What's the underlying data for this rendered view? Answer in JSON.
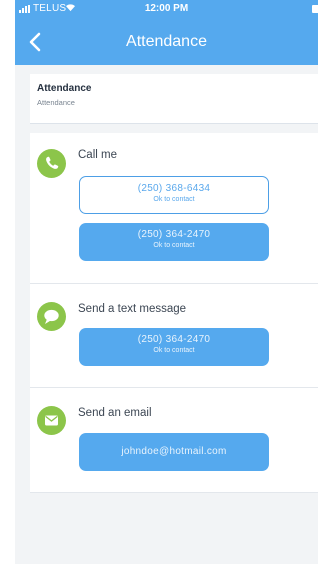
{
  "status_bar": {
    "carrier": "TELUS",
    "time": "12:00 PM"
  },
  "nav": {
    "title": "Attendance",
    "back_icon": "chevron-left-icon"
  },
  "header_card": {
    "title": "Attendance",
    "subtitle": "Attendance"
  },
  "call": {
    "label": "Call me",
    "icon": "phone-icon",
    "options": [
      {
        "number": "(250) 368-6434",
        "note": "Ok to contact"
      },
      {
        "number": "(250) 364-2470",
        "note": "Ok to contact"
      }
    ]
  },
  "text": {
    "label": "Send a text message",
    "icon": "chat-bubble-icon",
    "options": [
      {
        "number": "(250) 364-2470",
        "note": "Ok to contact"
      }
    ]
  },
  "email": {
    "label": "Send an email",
    "icon": "envelope-icon",
    "address": "johndoe@hotmail.com"
  },
  "colors": {
    "primary": "#55a9ee",
    "icon_green": "#8cc54a",
    "background": "#f2f4f6"
  }
}
